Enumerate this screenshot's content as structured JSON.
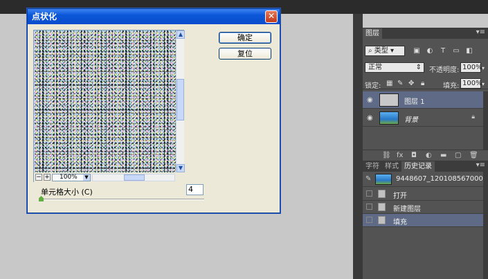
{
  "dialog": {
    "title": "点状化",
    "close_glyph": "✕",
    "ok_label": "确定",
    "reset_label": "复位",
    "zoom_value": "100%",
    "zoom_minus": "−",
    "zoom_plus": "+",
    "cell_size_label": "单元格大小 (C)",
    "cell_size_value": "4"
  },
  "layers_panel": {
    "tab_label": "图层",
    "kind_label": "类型",
    "blend_mode": "正常",
    "opacity_label": "不透明度:",
    "opacity_value": "100%",
    "lock_label": "锁定:",
    "fill_label": "填充:",
    "fill_value": "100%",
    "layers": [
      {
        "name": "图层 1",
        "selected": true
      },
      {
        "name": "背景",
        "selected": false
      }
    ]
  },
  "history_panel": {
    "tabs": [
      "字符",
      "样式",
      "历史记录"
    ],
    "snapshot_name": "9448607_120108567000_2...",
    "states": [
      {
        "label": "打开",
        "selected": false
      },
      {
        "label": "新建图层",
        "selected": false
      },
      {
        "label": "填充",
        "selected": true
      }
    ]
  },
  "colors": {
    "selection_blue": "#5f6b86",
    "panel_bg": "#535353",
    "dialog_bg": "#ece9d8"
  }
}
